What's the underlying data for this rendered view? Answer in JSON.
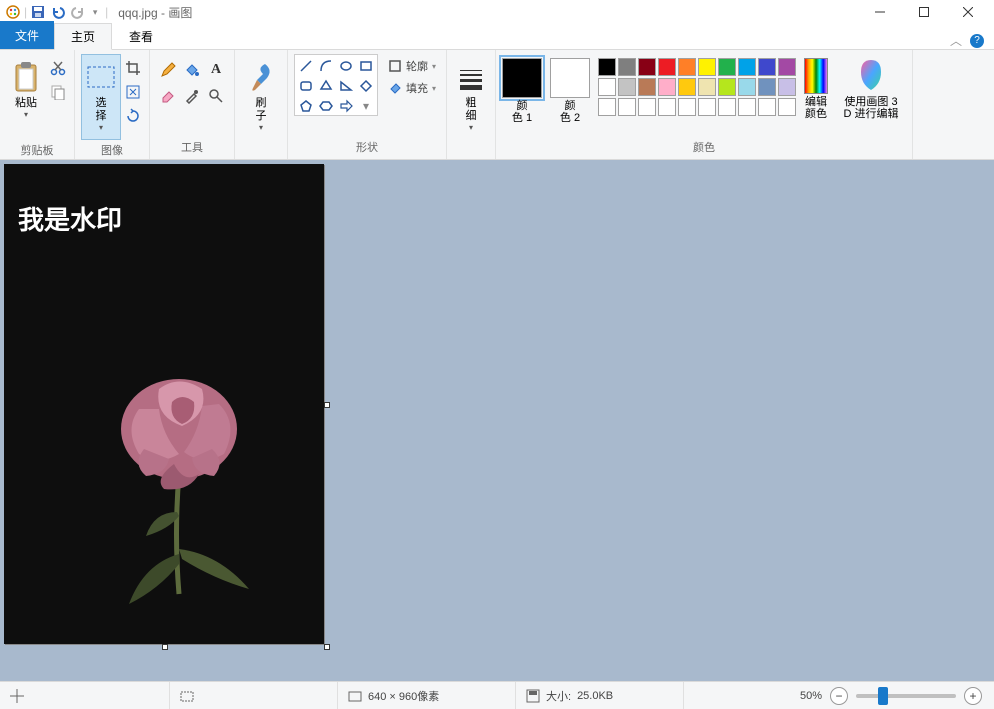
{
  "title": {
    "filename": "qqq.jpg",
    "app": "画图"
  },
  "tabs": {
    "file": "文件",
    "home": "主页",
    "view": "查看"
  },
  "ribbon": {
    "clipboard": {
      "label": "剪贴板",
      "paste": "粘贴"
    },
    "image": {
      "label": "图像",
      "select": "选\n择"
    },
    "tools": {
      "label": "工具"
    },
    "brushes": {
      "label": "刷\n子"
    },
    "shapes": {
      "label": "形状",
      "outline": "轮廓",
      "fill": "填充"
    },
    "thickness": {
      "label": "粗\n细"
    },
    "colors": {
      "label": "颜色",
      "c1": "颜\n色 1",
      "c2": "颜\n色 2",
      "edit": "编辑\n颜色",
      "p3d": "使用画图 3\nD 进行编辑"
    }
  },
  "palette": {
    "row1": [
      "#000000",
      "#7f7f7f",
      "#880015",
      "#ed1c24",
      "#ff7f27",
      "#fff200",
      "#22b14c",
      "#00a2e8",
      "#3f48cc",
      "#a349a4"
    ],
    "row2": [
      "#ffffff",
      "#c3c3c3",
      "#b97a57",
      "#ffaec9",
      "#ffc90e",
      "#efe4b0",
      "#b5e61d",
      "#99d9ea",
      "#7092be",
      "#c8bfe7"
    ],
    "row3": [
      "#ffffff",
      "#ffffff",
      "#ffffff",
      "#ffffff",
      "#ffffff",
      "#ffffff",
      "#ffffff",
      "#ffffff",
      "#ffffff",
      "#ffffff"
    ]
  },
  "canvas": {
    "watermark": "我是水印"
  },
  "status": {
    "dimensions": "640 × 960像素",
    "size_label": "大小:",
    "size_value": "25.0KB",
    "zoom": "50%"
  }
}
